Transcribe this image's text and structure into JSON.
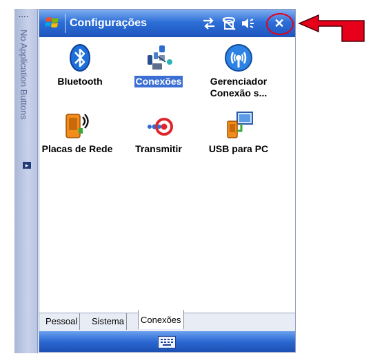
{
  "side_strip": {
    "dots": "....",
    "text": "No Application Buttons",
    "arrow": "▸"
  },
  "titlebar": {
    "title": "Configurações",
    "close": "✕"
  },
  "items": [
    {
      "label": "Bluetooth",
      "icon": "bluetooth-icon"
    },
    {
      "label": "Conexões",
      "icon": "connections-icon",
      "selected": true
    },
    {
      "label": "Gerenciador Conexão s...",
      "icon": "wireless-manager-icon"
    },
    {
      "label": "Placas de Rede",
      "icon": "network-cards-icon"
    },
    {
      "label": "Transmitir",
      "icon": "beam-icon"
    },
    {
      "label": "USB para PC",
      "icon": "usb-to-pc-icon"
    }
  ],
  "tabs": [
    {
      "label": "Pessoal"
    },
    {
      "label": "Sistema"
    },
    {
      "label": "Conexões",
      "active": true
    }
  ],
  "colors": {
    "title_bar": "#2e6fd8",
    "selection": "#3b6fd3",
    "annotation_red": "#e6001a"
  }
}
